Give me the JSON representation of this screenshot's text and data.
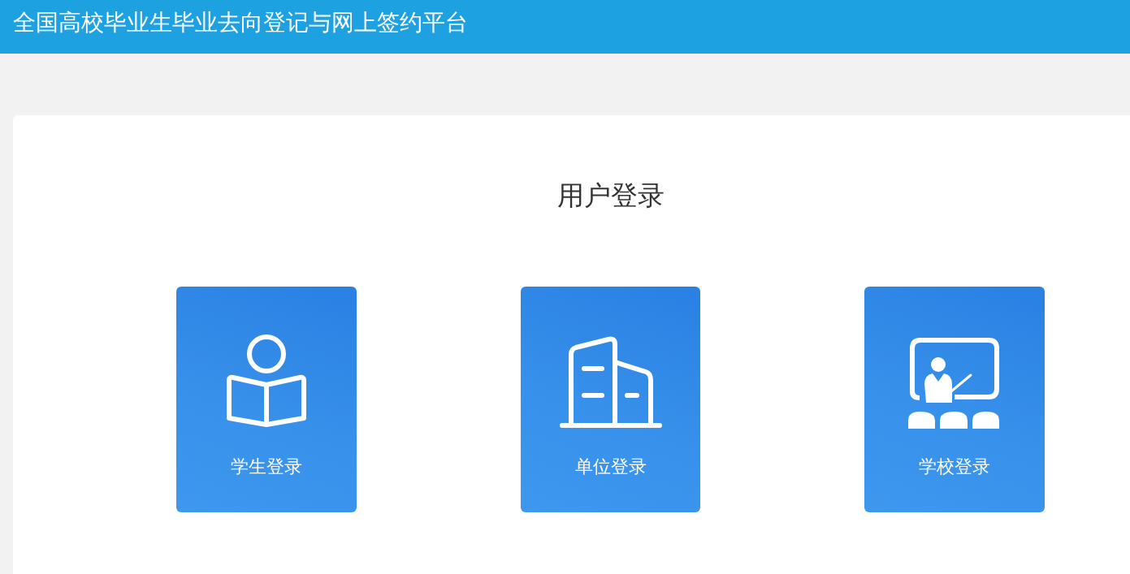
{
  "header": {
    "title": "全国高校毕业生毕业去向登记与网上签约平台"
  },
  "login": {
    "title": "用户登录",
    "options": [
      {
        "kind": "student",
        "label": "学生登录"
      },
      {
        "kind": "employer",
        "label": "单位登录"
      },
      {
        "kind": "school",
        "label": "学校登录"
      }
    ]
  }
}
